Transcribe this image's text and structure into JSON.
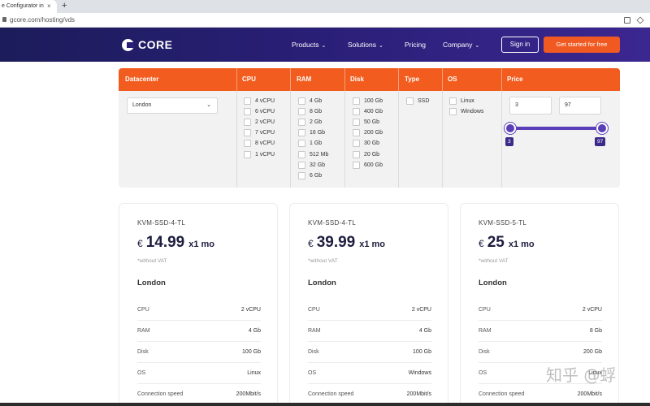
{
  "browser": {
    "tab_title": "e Configurator in",
    "tab_close": "×",
    "new_tab": "+",
    "url": "gcore.com/hosting/vds"
  },
  "header": {
    "logo_text": "CORE",
    "nav": [
      {
        "label": "Products",
        "dropdown": true
      },
      {
        "label": "Solutions",
        "dropdown": true
      },
      {
        "label": "Pricing",
        "dropdown": false
      },
      {
        "label": "Company",
        "dropdown": true
      }
    ],
    "chevron": "⌄",
    "signin": "Sign in",
    "cta": "Get started for free",
    "colors": {
      "navbar": "#2a1f78",
      "accent": "#f05a22"
    }
  },
  "filter": {
    "columns": [
      "Datacenter",
      "CPU",
      "RAM",
      "Disk",
      "Type",
      "OS",
      "Price"
    ],
    "datacenter": {
      "selected": "London",
      "arrow": "⌄"
    },
    "cpu": [
      "4 vCPU",
      "6 vCPU",
      "2 vCPU",
      "7 vCPU",
      "8 vCPU",
      "1 vCPU"
    ],
    "ram": [
      "4 Gb",
      "8 Gb",
      "2 Gb",
      "16 Gb",
      "1 Gb",
      "512 Mb",
      "32 Gb",
      "6 Gb"
    ],
    "disk": [
      "100 Gb",
      "400 Gb",
      "50 Gb",
      "200 Gb",
      "30 Gb",
      "20 Gb",
      "600 Gb"
    ],
    "type": [
      "SSD"
    ],
    "os": [
      "Linux",
      "Windows"
    ],
    "price": {
      "min": "3",
      "max": "97",
      "min_badge": "3",
      "max_badge": "97"
    },
    "colors": {
      "header": "#f25c1e",
      "slider": "#5b3fb8"
    }
  },
  "cards": [
    {
      "name": "KVM-SSD-4-TL",
      "currency": "€",
      "price": "14.99",
      "period": "x1 mo",
      "vat": "*without VAT",
      "location": "London",
      "specs": [
        {
          "k": "CPU",
          "v": "2 vCPU"
        },
        {
          "k": "RAM",
          "v": "4 Gb"
        },
        {
          "k": "Disk",
          "v": "100 Gb"
        },
        {
          "k": "OS",
          "v": "Linux"
        },
        {
          "k": "Connection speed",
          "v": "200Mbit/s"
        }
      ]
    },
    {
      "name": "KVM-SSD-4-TL",
      "currency": "€",
      "price": "39.99",
      "period": "x1 mo",
      "vat": "*without VAT",
      "location": "London",
      "specs": [
        {
          "k": "CPU",
          "v": "2 vCPU"
        },
        {
          "k": "RAM",
          "v": "4 Gb"
        },
        {
          "k": "Disk",
          "v": "100 Gb"
        },
        {
          "k": "OS",
          "v": "Windows"
        },
        {
          "k": "Connection speed",
          "v": "200Mbit/s"
        }
      ]
    },
    {
      "name": "KVM-SSD-5-TL",
      "currency": "€",
      "price": "25",
      "period": "x1 mo",
      "vat": "*without VAT",
      "location": "London",
      "specs": [
        {
          "k": "CPU",
          "v": "2 vCPU"
        },
        {
          "k": "RAM",
          "v": "8 Gb"
        },
        {
          "k": "Disk",
          "v": "200 Gb"
        },
        {
          "k": "OS",
          "v": "Linux"
        },
        {
          "k": "Connection speed",
          "v": "200Mbit/s"
        }
      ]
    }
  ],
  "watermark": "知乎 @蜉"
}
